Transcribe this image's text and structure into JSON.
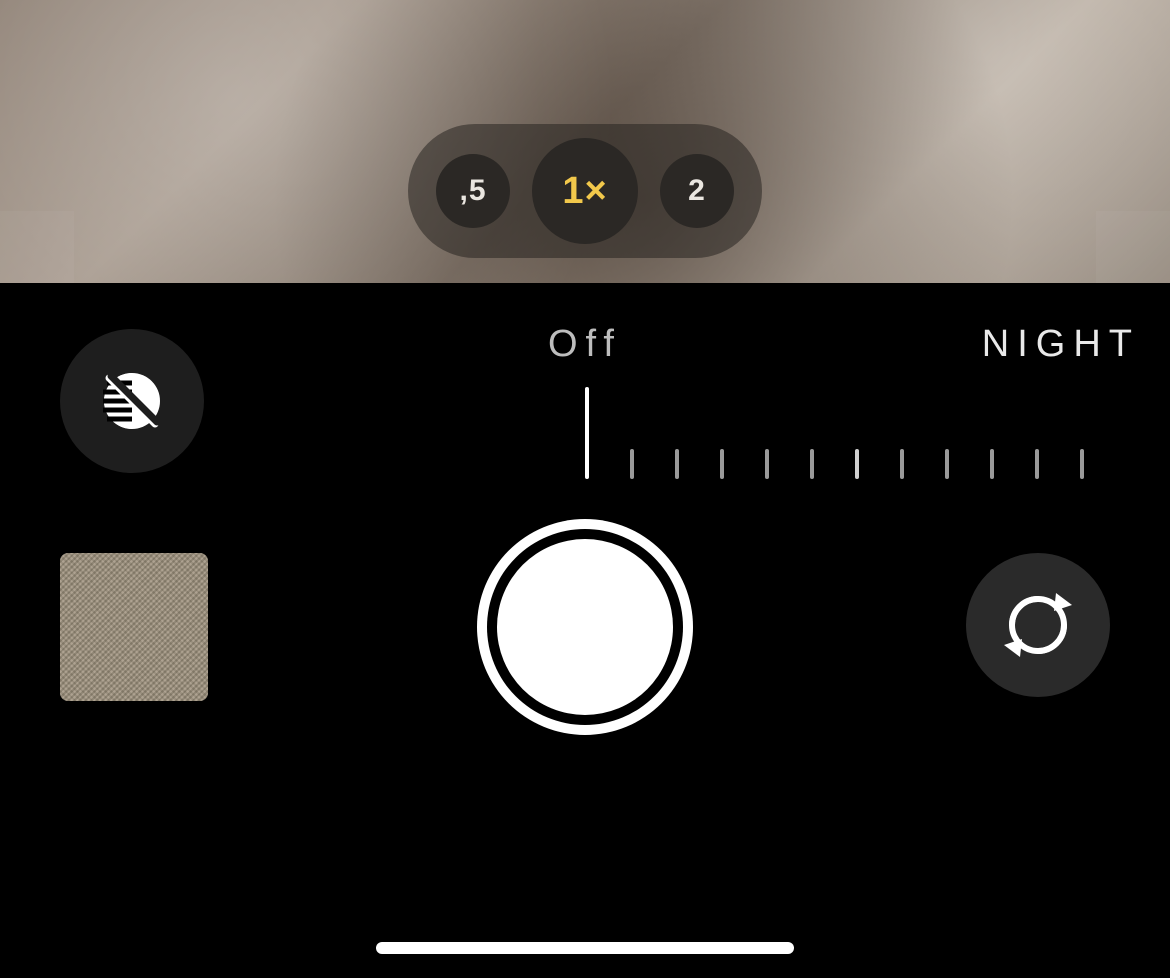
{
  "zoom": {
    "options": [
      {
        "label": ",5",
        "selected": false
      },
      {
        "label": "1×",
        "selected": true
      },
      {
        "label": "2",
        "selected": false
      }
    ]
  },
  "night": {
    "state_label": "Off",
    "mode_label": "NIGHT",
    "tick_count": 12
  },
  "icons": {
    "filters": "filters-off-icon",
    "flip": "flip-camera-icon"
  }
}
